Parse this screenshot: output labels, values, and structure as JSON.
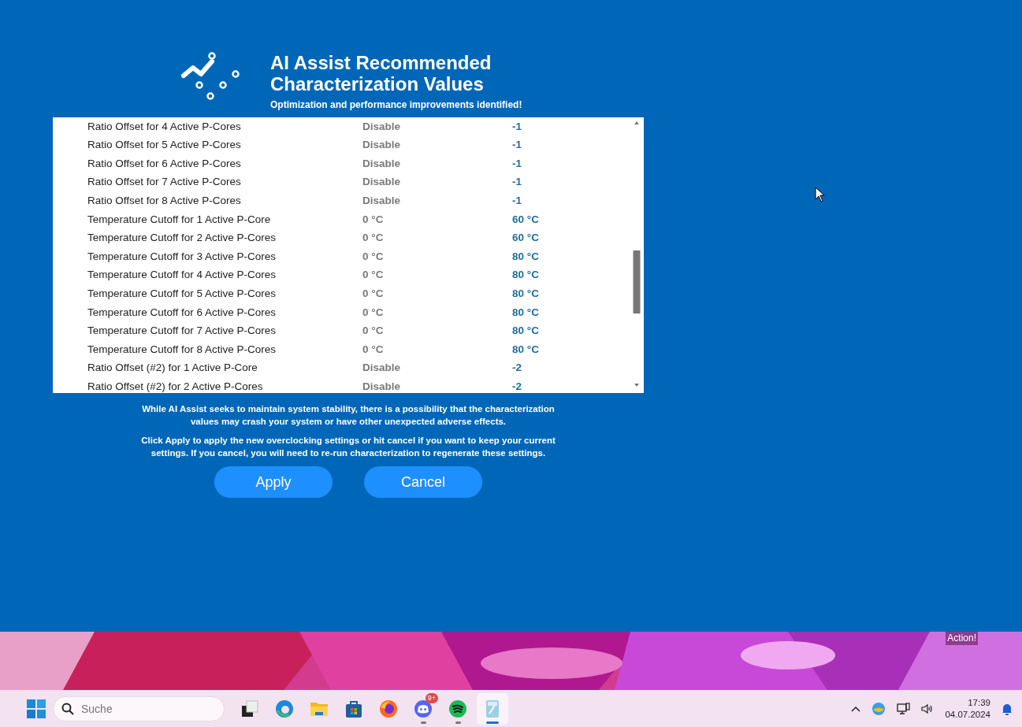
{
  "header": {
    "title": "AI Assist Recommended Characterization Values",
    "subtitle": "Optimization and performance improvements identified!"
  },
  "settings": {
    "rows": [
      {
        "name": "Ratio Offset for 4 Active P-Cores",
        "current": "Disable",
        "recommended": "-1"
      },
      {
        "name": "Ratio Offset for 5 Active P-Cores",
        "current": "Disable",
        "recommended": "-1"
      },
      {
        "name": "Ratio Offset for 6 Active P-Cores",
        "current": "Disable",
        "recommended": "-1"
      },
      {
        "name": "Ratio Offset for 7 Active P-Cores",
        "current": "Disable",
        "recommended": "-1"
      },
      {
        "name": "Ratio Offset for 8 Active P-Cores",
        "current": "Disable",
        "recommended": "-1"
      },
      {
        "name": "Temperature Cutoff for 1 Active P-Core",
        "current": "0 °C",
        "recommended": "60 °C"
      },
      {
        "name": "Temperature Cutoff for 2 Active P-Cores",
        "current": "0 °C",
        "recommended": "60 °C"
      },
      {
        "name": "Temperature Cutoff for 3 Active P-Cores",
        "current": "0 °C",
        "recommended": "80 °C"
      },
      {
        "name": "Temperature Cutoff for 4 Active P-Cores",
        "current": "0 °C",
        "recommended": "80 °C"
      },
      {
        "name": "Temperature Cutoff for 5 Active P-Cores",
        "current": "0 °C",
        "recommended": "80 °C"
      },
      {
        "name": "Temperature Cutoff for 6 Active P-Cores",
        "current": "0 °C",
        "recommended": "80 °C"
      },
      {
        "name": "Temperature Cutoff for 7 Active P-Cores",
        "current": "0 °C",
        "recommended": "80 °C"
      },
      {
        "name": "Temperature Cutoff for 8 Active P-Cores",
        "current": "0 °C",
        "recommended": "80 °C"
      },
      {
        "name": "Ratio Offset (#2) for 1 Active P-Core",
        "current": "Disable",
        "recommended": "-2"
      },
      {
        "name": "Ratio Offset (#2) for 2 Active P-Cores",
        "current": "Disable",
        "recommended": "-2"
      }
    ]
  },
  "notices": [
    "While AI Assist seeks to maintain system stability, there is a possibility that the characterization values may crash your system or have other unexpected adverse effects.",
    "Click Apply to apply the new overclocking settings or hit cancel if you want to keep your current settings. If you cancel, you will need to re-run characterization to regenerate these settings."
  ],
  "buttons": [
    {
      "label": "Apply"
    },
    {
      "label": "Cancel"
    }
  ],
  "recorder_label": "Action!",
  "taskbar": {
    "search": {
      "placeholder": "Suche"
    },
    "apps": [
      {
        "kind": "taskview",
        "running": false,
        "selected": false
      },
      {
        "kind": "browser",
        "running": false,
        "selected": false
      },
      {
        "kind": "folder",
        "running": false,
        "selected": false
      },
      {
        "kind": "store",
        "running": false,
        "selected": false
      },
      {
        "kind": "fox",
        "running": false,
        "selected": false
      },
      {
        "kind": "chat",
        "running": true,
        "selected": false,
        "badge": "9+"
      },
      {
        "kind": "music",
        "running": true,
        "selected": false
      },
      {
        "kind": "tool",
        "running": true,
        "selected": true
      }
    ],
    "clock": {
      "time": "17:39",
      "date": "04.07.2024"
    }
  }
}
